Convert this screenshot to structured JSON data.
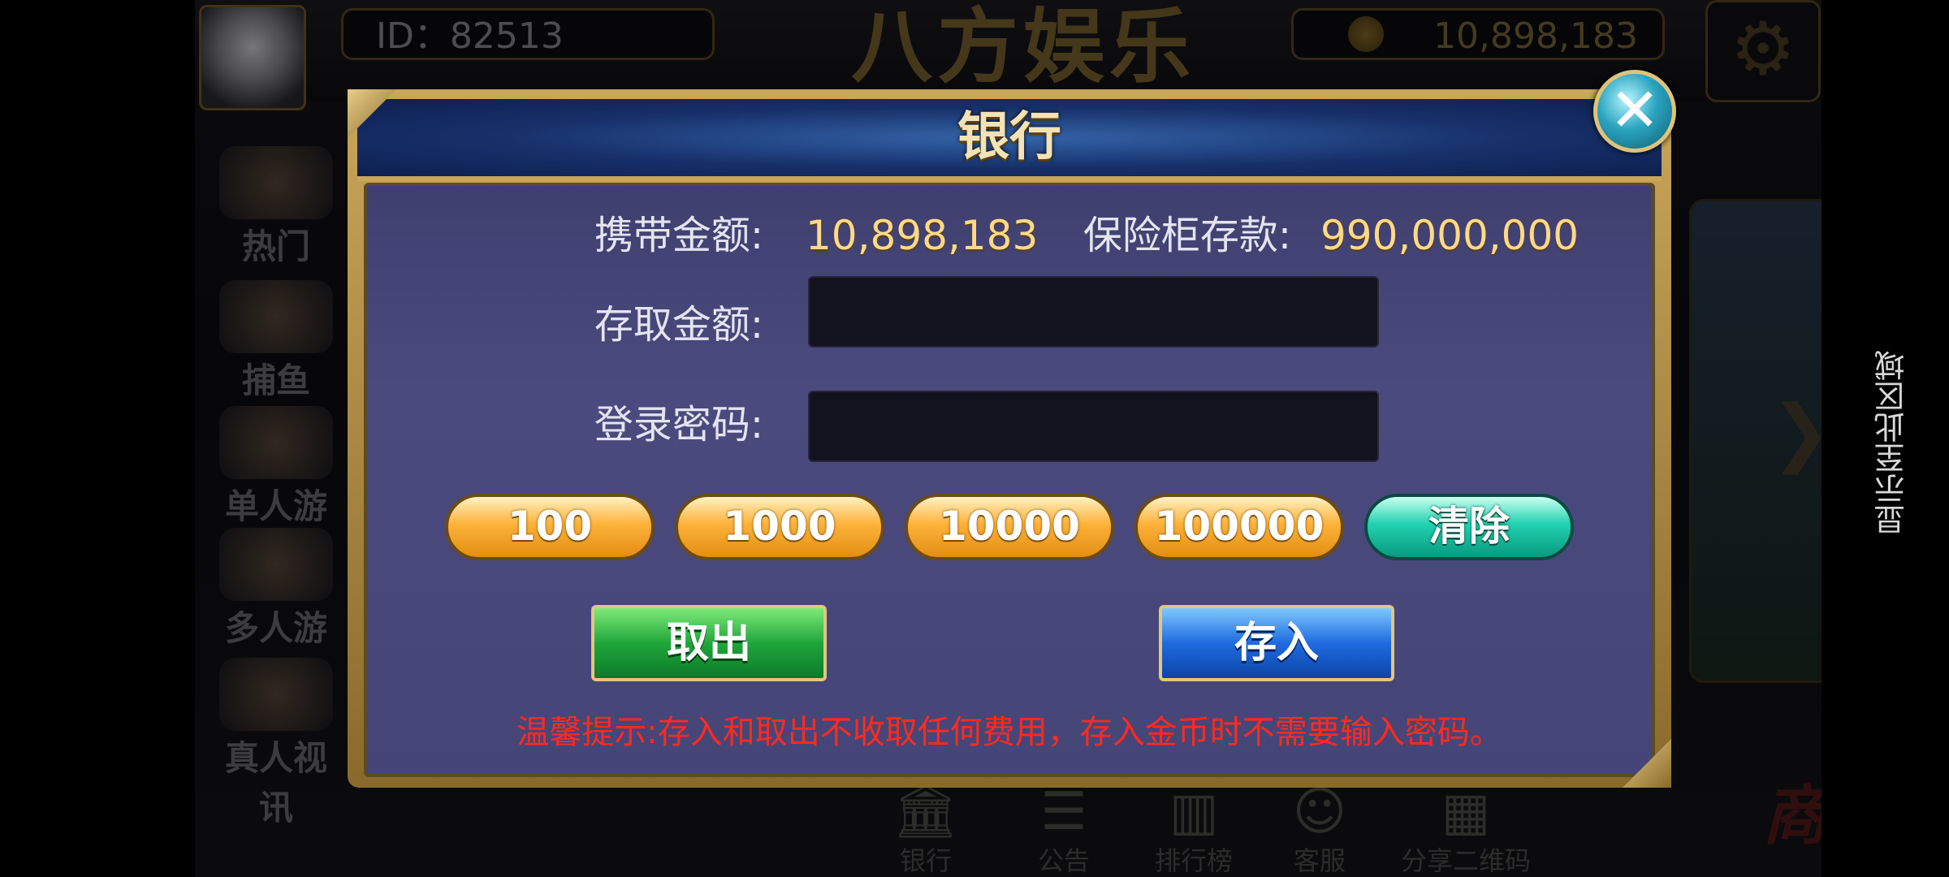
{
  "header": {
    "id_text": "ID：82513",
    "logo_text": "八方娱乐",
    "coins": "10,898,183"
  },
  "sidebar": {
    "items": [
      {
        "label": "热门"
      },
      {
        "label": "捕鱼"
      },
      {
        "label": "单人游戏"
      },
      {
        "label": "多人游戏"
      },
      {
        "label": "真人视讯"
      }
    ]
  },
  "bottom_nav": {
    "items": [
      {
        "label": "银行",
        "icon": "bank-icon"
      },
      {
        "label": "公告",
        "icon": "notice-icon"
      },
      {
        "label": "排行榜",
        "icon": "ranking-icon"
      },
      {
        "label": "客服",
        "icon": "service-icon"
      },
      {
        "label": "分享二维码",
        "icon": "qr-icon"
      }
    ],
    "shop_label": "商城SHOP"
  },
  "side_text": "显示至此区域",
  "dialog": {
    "title": "银行",
    "carry_label": "携带金额:",
    "carry_value": "10,898,183",
    "safe_label": "保险柜存款:",
    "safe_value": "990,000,000",
    "amount_label": "存取金额:",
    "amount_value": "",
    "password_label": "登录密码:",
    "password_value": "",
    "quick_amounts": [
      "100",
      "1000",
      "10000",
      "100000"
    ],
    "clear_label": "清除",
    "withdraw_label": "取出",
    "deposit_label": "存入",
    "tip": "温馨提示:存入和取出不收取任何费用，存入金币时不需要输入密码。"
  },
  "colors": {
    "title_gold": "#f3e2b5",
    "value_gold": "#ffd987",
    "tip_red": "#ff2a20",
    "withdraw_green": "#1fa63a",
    "deposit_blue": "#1e6be0",
    "clear_teal": "#21d2b0"
  }
}
